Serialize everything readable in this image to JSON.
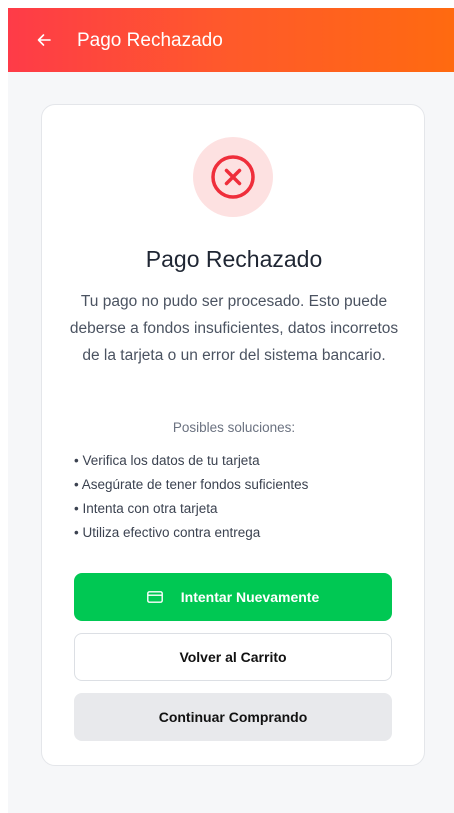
{
  "header": {
    "title": "Pago Rechazado",
    "back_icon": "arrow-left-icon"
  },
  "status": {
    "icon": "x-circle-icon",
    "icon_color": "#ef2e3b",
    "background_color": "#fde1e1"
  },
  "card": {
    "title": "Pago Rechazado",
    "description": "Tu pago no pudo ser procesado. Esto puede deberse a fondos insuficientes, datos incorretos de la tarjeta o un error del sistema bancario."
  },
  "solutions": {
    "title": "Posibles soluciones:",
    "items": [
      "• Verifica los datos de tu tarjeta",
      "• Asegúrate de tener fondos suficientes",
      "• Intenta con otra tarjeta",
      "• Utiliza efectivo contra entrega"
    ]
  },
  "actions": {
    "retry_label": "Intentar Nuevamente",
    "retry_icon": "credit-card-icon",
    "cart_label": "Volver al Carrito",
    "continue_label": "Continuar Comprando"
  },
  "colors": {
    "header_gradient_start": "#fe3b48",
    "header_gradient_end": "#ff6a10",
    "primary_button": "#00c853",
    "secondary_button": "#e8e9ec"
  }
}
